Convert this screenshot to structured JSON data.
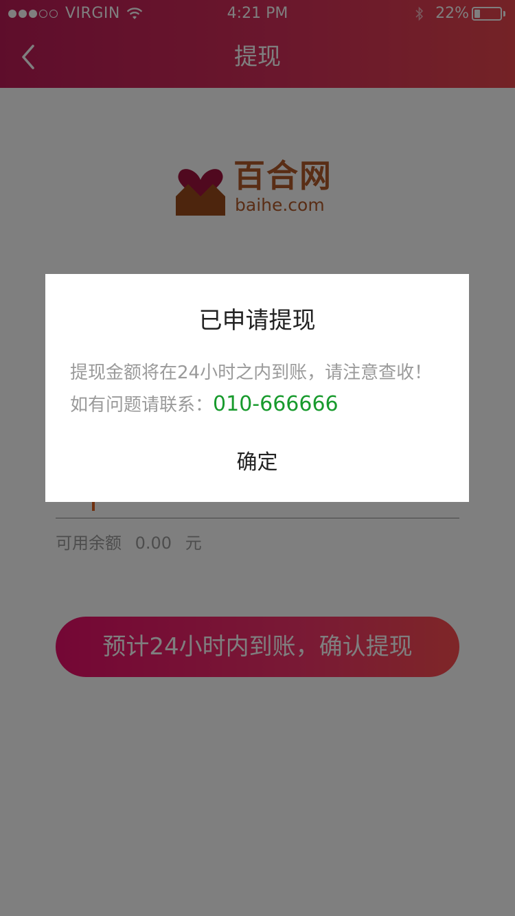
{
  "status_bar": {
    "carrier": "VIRGIN",
    "signal_bars": 3,
    "signal_total": 5,
    "time": "4:21 PM",
    "battery_text": "22%",
    "battery_level": 0.22,
    "icons": [
      "wifi-icon",
      "bluetooth-icon",
      "battery-icon"
    ]
  },
  "nav": {
    "title": "提现",
    "back_icon": "chevron-left-icon"
  },
  "logo": {
    "name_cn": "百合网",
    "domain": "baihe.com",
    "colors": {
      "heart": "#a0123f",
      "base": "#9b4a1a"
    }
  },
  "form": {
    "balance_label": "可用余额",
    "balance_value": "0.00",
    "balance_unit": "元",
    "confirm_button": "预计24小时内到账，确认提现"
  },
  "dialog": {
    "title": "已申请提现",
    "message": "提现金额将在24小时之内到账，请注意查收！",
    "contact_label": "如有问题请联系：",
    "contact_phone": "010-666666",
    "ok_button": "确定"
  },
  "colors": {
    "header_start": "#bd1b57",
    "header_end": "#e8464d",
    "button_start": "#e90e6b",
    "button_end": "#fd4d50",
    "phone": "#179a2c",
    "overlay": "rgba(0,0,0,0.5)"
  }
}
